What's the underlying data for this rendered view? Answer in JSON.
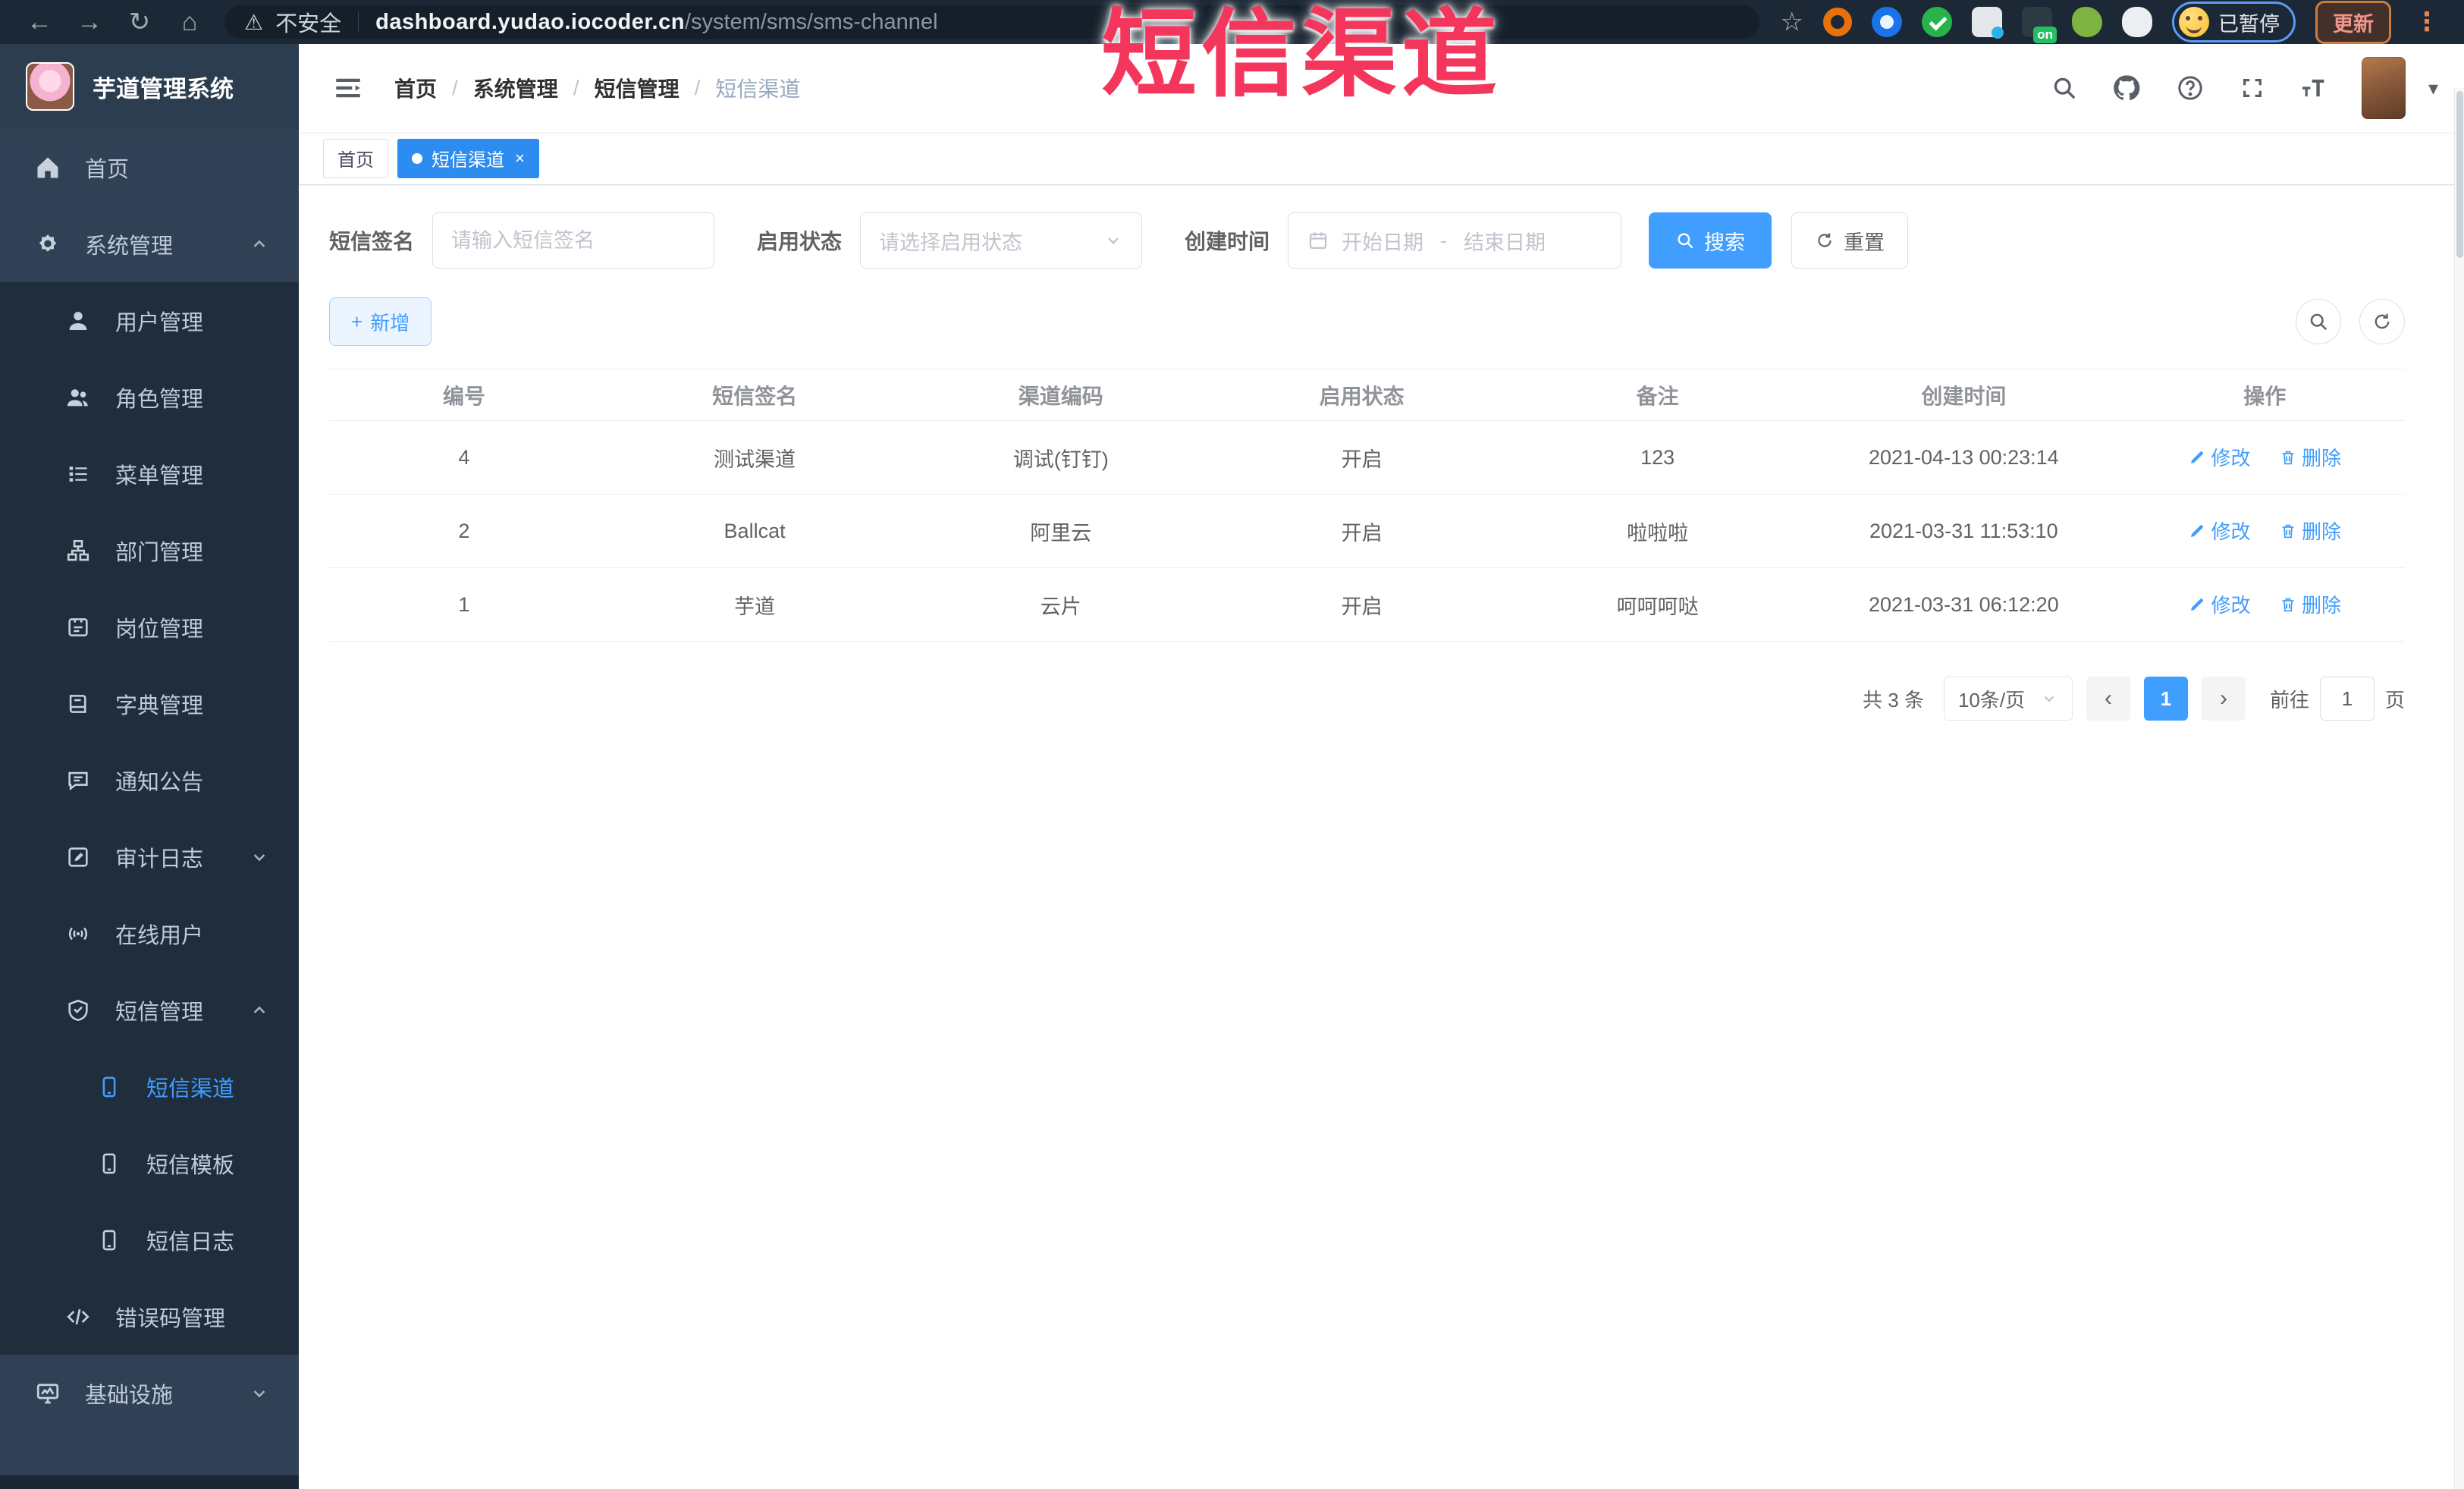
{
  "colors": {
    "accent": "#409eff",
    "tab_active": "#2d8cf0",
    "link": "#409eff",
    "overlay_red": "#f5365c",
    "sidebar_bg": "#304156",
    "submenu_bg": "#1f2d3d",
    "browser_bar_bg": "#1c2835"
  },
  "icons": {
    "back": "←",
    "forward": "→",
    "reload": "↻",
    "home": "⌂",
    "warning": "⚠",
    "star": "☆",
    "kebab": "⋮",
    "caret_down": "▾",
    "prev": "‹",
    "next": "›",
    "plus": "+",
    "close": "×"
  },
  "overlay": {
    "text": "短信渠道"
  },
  "browser": {
    "security_label": "不安全",
    "url_domain": "dashboard.yudao.iocoder.cn",
    "url_path": "/system/sms/sms-channel",
    "paused_badge": "已暂停",
    "update_label": "更新"
  },
  "sidebar": {
    "logo_title": "芋道管理系统",
    "items": [
      {
        "label": "首页"
      },
      {
        "label": "系统管理"
      },
      {
        "label": "用户管理"
      },
      {
        "label": "角色管理"
      },
      {
        "label": "菜单管理"
      },
      {
        "label": "部门管理"
      },
      {
        "label": "岗位管理"
      },
      {
        "label": "字典管理"
      },
      {
        "label": "通知公告"
      },
      {
        "label": "审计日志"
      },
      {
        "label": "在线用户"
      },
      {
        "label": "短信管理"
      },
      {
        "label": "短信渠道"
      },
      {
        "label": "短信模板"
      },
      {
        "label": "短信日志"
      },
      {
        "label": "错误码管理"
      },
      {
        "label": "基础设施"
      }
    ]
  },
  "header": {
    "breadcrumb": [
      "首页",
      "系统管理",
      "短信管理",
      "短信渠道"
    ],
    "separator": "/"
  },
  "tabs": [
    {
      "label": "首页"
    },
    {
      "label": "短信渠道"
    }
  ],
  "filters": {
    "sign_label": "短信签名",
    "sign_placeholder": "请输入短信签名",
    "status_label": "启用状态",
    "status_placeholder": "请选择启用状态",
    "time_label": "创建时间",
    "start_placeholder": "开始日期",
    "range_separator": "-",
    "end_placeholder": "结束日期",
    "search_label": "搜索",
    "reset_label": "重置"
  },
  "toolbar": {
    "add_label": "新增"
  },
  "table": {
    "headers": [
      "编号",
      "短信签名",
      "渠道编码",
      "启用状态",
      "备注",
      "创建时间",
      "操作"
    ],
    "rows": [
      [
        "4",
        "测试渠道",
        "调试(钉钉)",
        "开启",
        "123",
        "2021-04-13 00:23:14"
      ],
      [
        "2",
        "Ballcat",
        "阿里云",
        "开启",
        "啦啦啦",
        "2021-03-31 11:53:10"
      ],
      [
        "1",
        "芋道",
        "云片",
        "开启",
        "呵呵呵哒",
        "2021-03-31 06:12:20"
      ]
    ],
    "edit_label": "修改",
    "delete_label": "删除"
  },
  "pagination": {
    "total_text": "共 3 条",
    "page_size": "10条/页",
    "current_page": "1",
    "goto_label": "前往",
    "goto_value": "1",
    "page_unit": "页"
  }
}
